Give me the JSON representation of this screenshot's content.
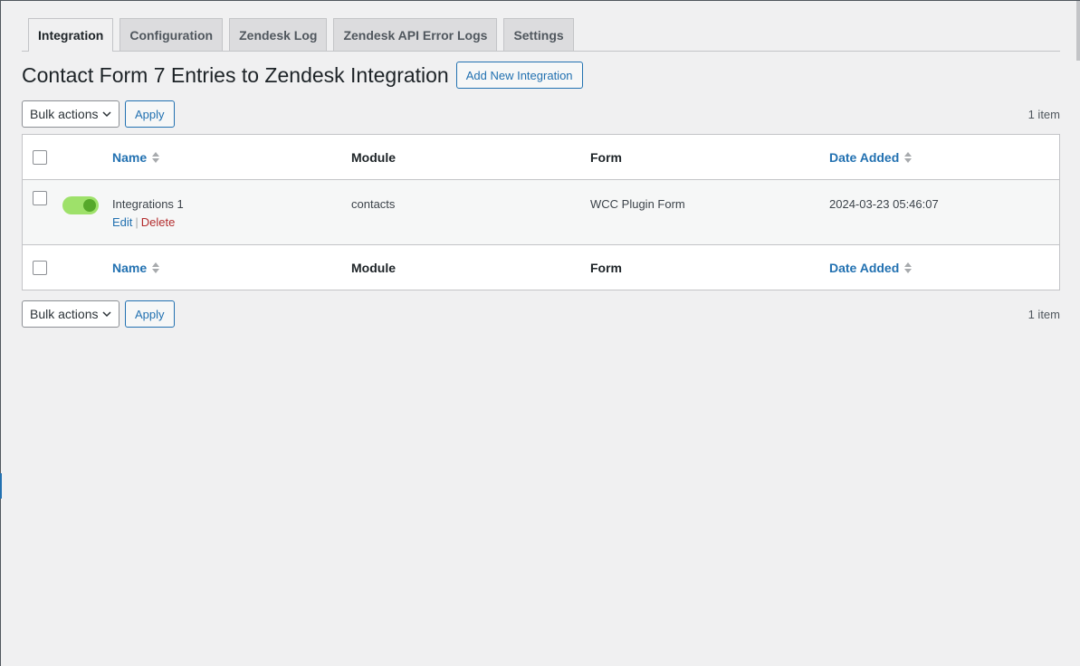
{
  "tabs": [
    {
      "label": "Integration",
      "active": true
    },
    {
      "label": "Configuration",
      "active": false
    },
    {
      "label": "Zendesk Log",
      "active": false
    },
    {
      "label": "Zendesk API Error Logs",
      "active": false
    },
    {
      "label": "Settings",
      "active": false
    }
  ],
  "page": {
    "title": "Contact Form 7 Entries to Zendesk Integration",
    "add_new_label": "Add New Integration"
  },
  "tablenav": {
    "bulk_actions_label": "Bulk actions",
    "apply_label": "Apply",
    "items_count": "1 item"
  },
  "table": {
    "columns": {
      "name": "Name",
      "module": "Module",
      "form": "Form",
      "date_added": "Date Added"
    },
    "rows": [
      {
        "enabled": true,
        "name": "Integrations 1",
        "module": "contacts",
        "form": "WCC Plugin Form",
        "date_added": "2024-03-23 05:46:07",
        "edit_label": "Edit",
        "separator": "|",
        "delete_label": "Delete"
      }
    ]
  },
  "colors": {
    "accent": "#2271b1",
    "toggle_on": "#9ee16a",
    "delete": "#b32d2e",
    "background": "#f0f0f1"
  }
}
